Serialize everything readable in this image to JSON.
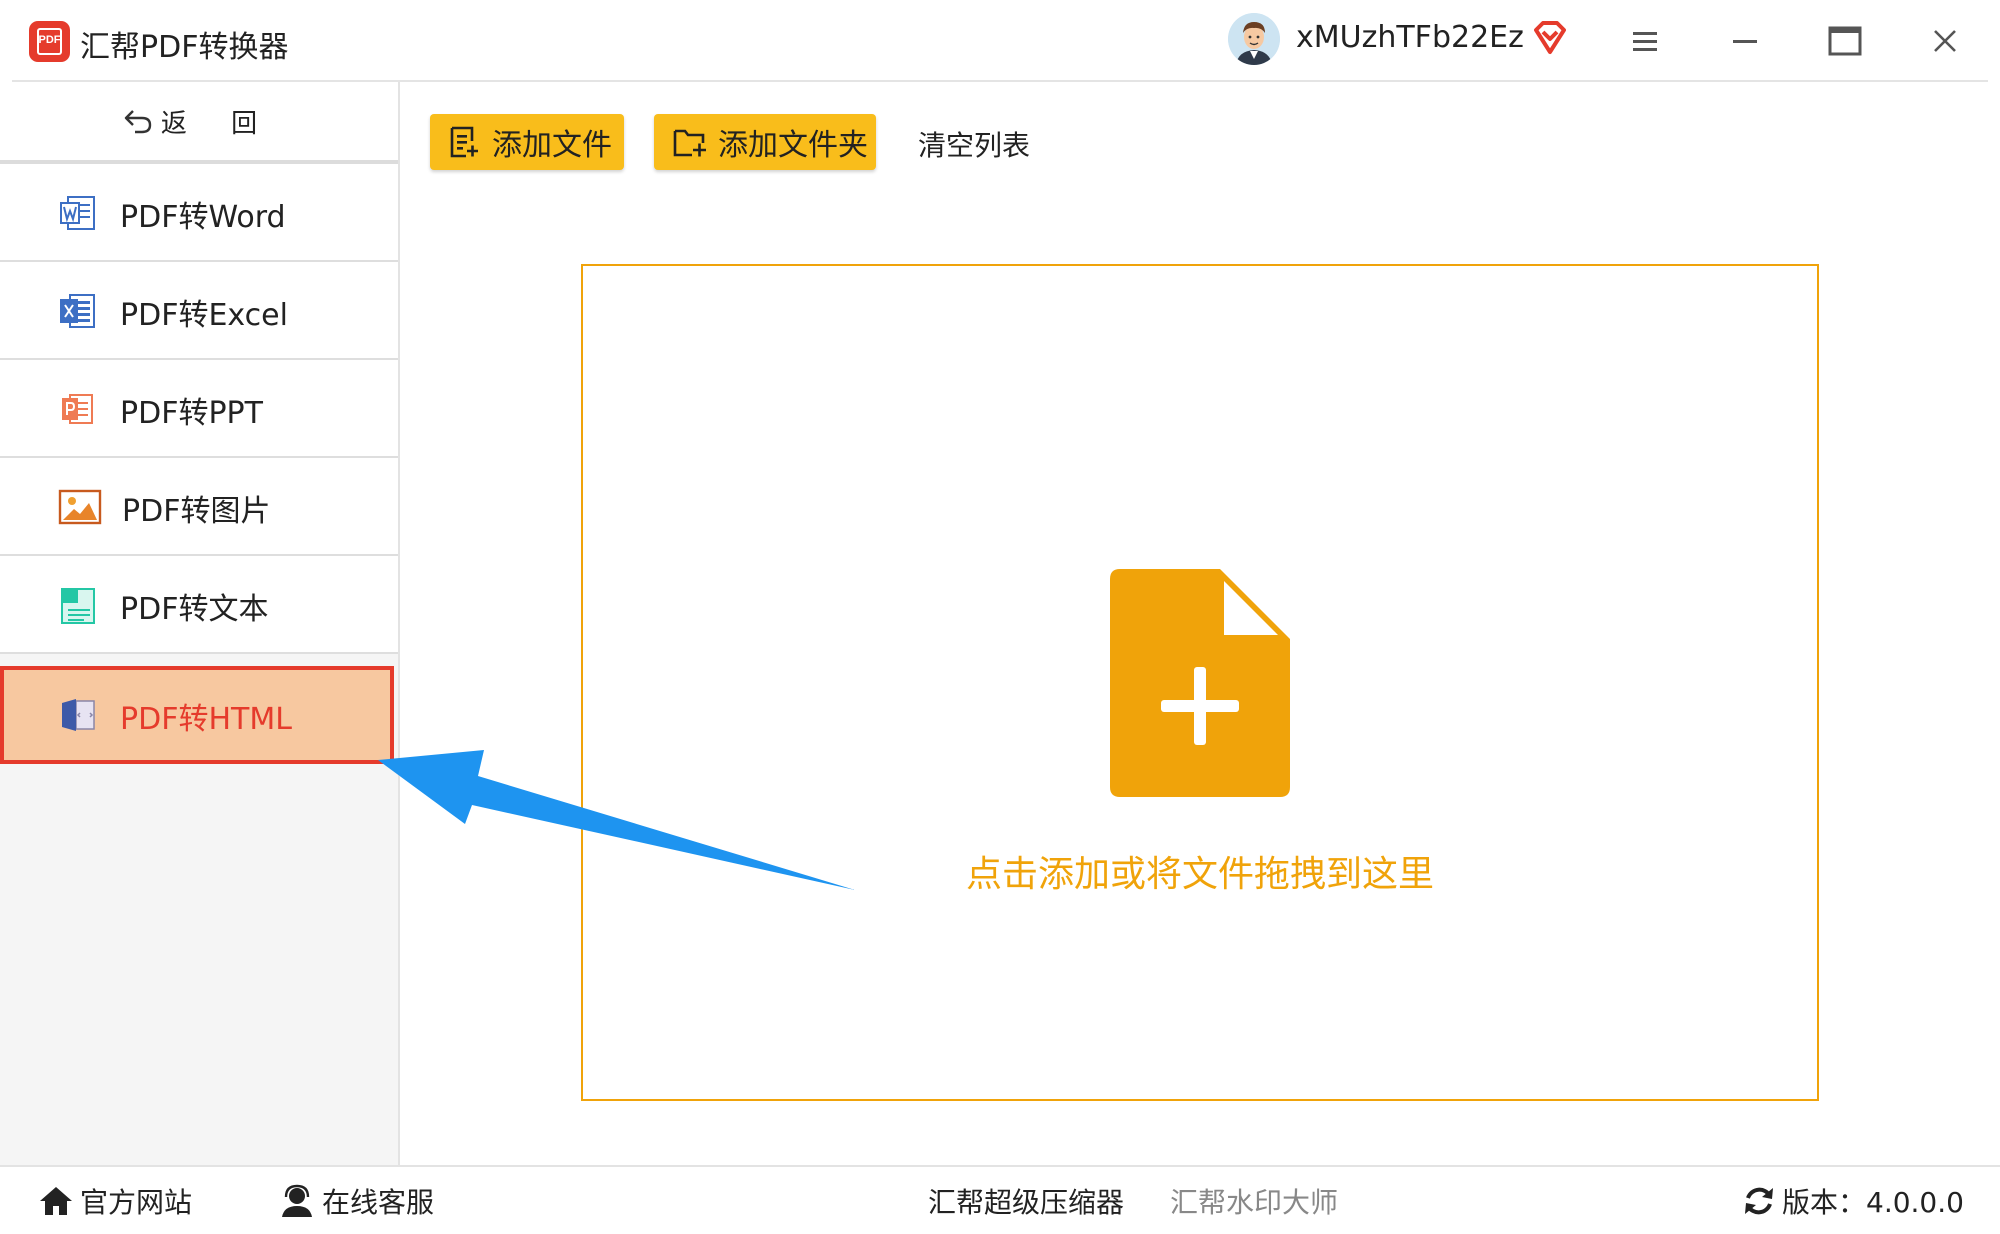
{
  "app": {
    "title": "汇帮PDF转换器",
    "logo_text": "PDF",
    "username": "xMUzhTFb22Ez",
    "brand_color": "#e53b2c",
    "accent_color": "#f9bd1b"
  },
  "window_controls": [
    "menu-icon",
    "minimize-icon",
    "maximize-icon",
    "close-icon"
  ],
  "sidebar": {
    "back_label": "返 回",
    "items": [
      {
        "label": "PDF转Word",
        "icon": "word-icon",
        "selected": false
      },
      {
        "label": "PDF转Excel",
        "icon": "excel-icon",
        "selected": false
      },
      {
        "label": "PDF转PPT",
        "icon": "ppt-icon",
        "selected": false
      },
      {
        "label": "PDF转图片",
        "icon": "image-icon",
        "selected": false
      },
      {
        "label": "PDF转文本",
        "icon": "text-icon",
        "selected": false
      },
      {
        "label": "PDF转HTML",
        "icon": "html-icon",
        "selected": true
      }
    ]
  },
  "toolbar": {
    "add_file": "添加文件",
    "add_folder": "添加文件夹",
    "clear_list": "清空列表"
  },
  "dropzone": {
    "hint": "点击添加或将文件拖拽到这里"
  },
  "footer": {
    "site": "官方网站",
    "support": "在线客服",
    "compressor": "汇帮超级压缩器",
    "watermark": "汇帮水印大师",
    "version": "版本：4.0.0.0"
  }
}
